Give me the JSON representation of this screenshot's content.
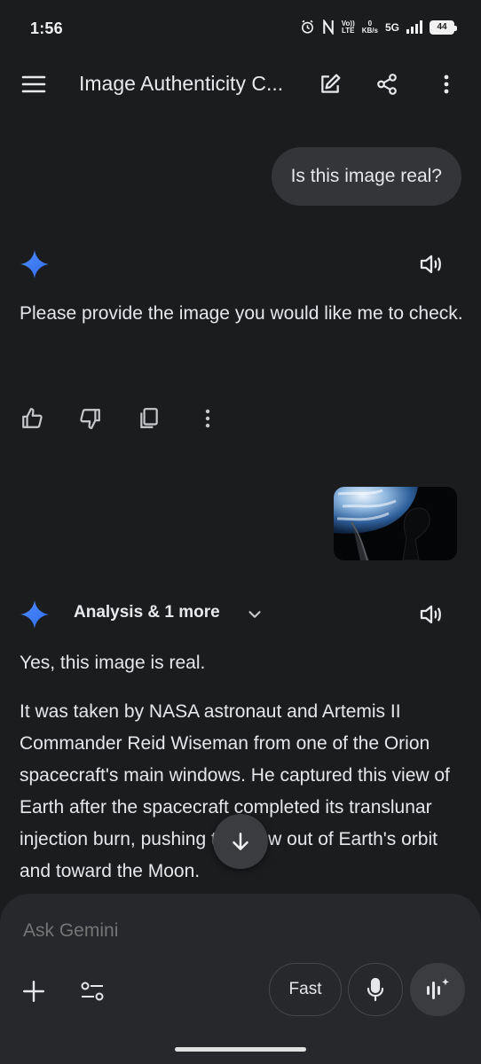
{
  "status_bar": {
    "time": "1:56",
    "volte_top": "Vo))",
    "volte_bottom": "LTE",
    "speed_value": "0",
    "speed_unit": "KB/s",
    "network": "5G",
    "battery": "44"
  },
  "app_bar": {
    "title": "Image Authenticity C...",
    "icons": [
      "menu-icon",
      "edit-icon",
      "share-icon",
      "more-vert-icon"
    ]
  },
  "conversation": {
    "user_message_1": "Is this image real?",
    "response_1": "Please provide the image you would like me to check.",
    "response_1_actions": [
      "thumb-up-icon",
      "thumb-down-icon",
      "copy-icon",
      "more-vert-icon"
    ],
    "response_2_chip": "Analysis & 1 more",
    "response_2_paragraph_1": "Yes, this image is real.",
    "response_2_paragraph_2": "It was taken by NASA astronaut and Artemis II Commander Reid Wiseman from one of the Orion spacecraft's main windows. He captured this view of Earth after the spacecraft completed its translunar injection burn, pushing the crew out of Earth's orbit and toward the Moon."
  },
  "composer": {
    "placeholder": "Ask Gemini",
    "mode_label": "Fast"
  },
  "colors": {
    "background": "#1b1c1e",
    "bubble": "#333538",
    "composer": "#26282b",
    "spark_blue": "#4f8dfd"
  }
}
